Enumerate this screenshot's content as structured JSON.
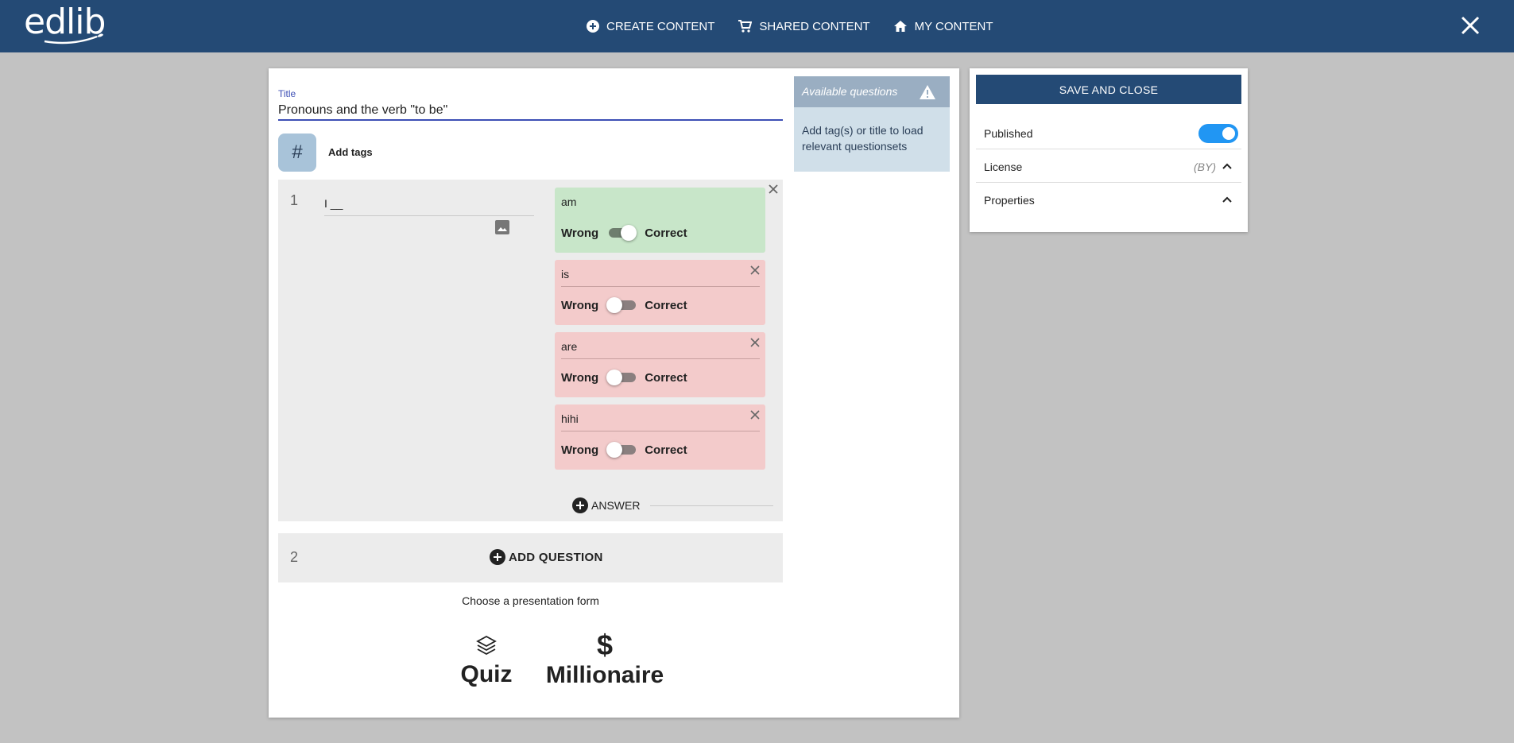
{
  "app": {
    "logo_text": "edlib"
  },
  "nav": [
    {
      "label": "CREATE CONTENT",
      "icon": "plus-circle-icon"
    },
    {
      "label": "SHARED CONTENT",
      "icon": "cart-icon"
    },
    {
      "label": "MY CONTENT",
      "icon": "home-icon"
    }
  ],
  "editor": {
    "title_label": "Title",
    "title_value": "Pronouns and the verb \"to be\"",
    "tags_label": "Add tags",
    "tag_symbol": "#",
    "questions": [
      {
        "number": "1",
        "text": "I __",
        "answers": [
          {
            "text": "am",
            "correct": true,
            "wrong_label": "Wrong",
            "correct_label": "Correct"
          },
          {
            "text": "is",
            "correct": false,
            "wrong_label": "Wrong",
            "correct_label": "Correct"
          },
          {
            "text": "are",
            "correct": false,
            "wrong_label": "Wrong",
            "correct_label": "Correct"
          },
          {
            "text": "hihi",
            "correct": false,
            "wrong_label": "Wrong",
            "correct_label": "Correct"
          }
        ],
        "add_answer_label": "ANSWER"
      }
    ],
    "next_question_number": "2",
    "add_question_label": "ADD QUESTION",
    "presentation_label": "Choose a presentation form",
    "forms": [
      {
        "label": "Quiz",
        "icon": "layers-icon"
      },
      {
        "label": "Millionaire",
        "icon": "dollar-icon",
        "symbol": "$"
      }
    ]
  },
  "available": {
    "title": "Available questions",
    "text": "Add tag(s) or title to load relevant questionsets"
  },
  "side": {
    "save_label": "SAVE AND CLOSE",
    "published_label": "Published",
    "published": true,
    "license_label": "License",
    "license_value": "(BY)",
    "properties_label": "Properties"
  },
  "colors": {
    "topbar": "#244a75",
    "correct_bg": "#c8e6c9",
    "wrong_bg": "#f3cbcb",
    "accent": "#2196f3"
  }
}
